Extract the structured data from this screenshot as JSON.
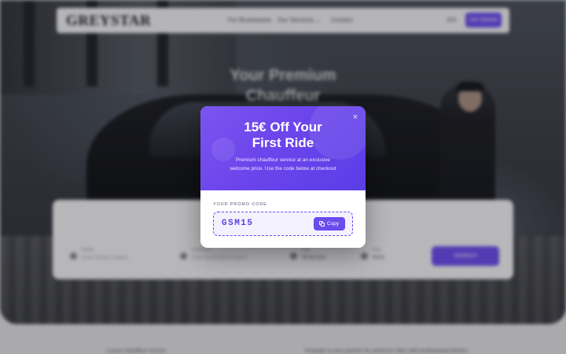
{
  "navbar": {
    "logo": "GREYSTAR",
    "links": [
      "For Businesses",
      "Our Services ⌄",
      "Contact"
    ],
    "lang": "EN",
    "cta": "Get Started"
  },
  "hero": {
    "title_line1": "Your Premium",
    "title_line2": "Chauffeur"
  },
  "booking": {
    "fields": [
      {
        "label": "Pickup",
        "value": "Enter Pickup Location",
        "icon": "location-pin-icon"
      },
      {
        "label": "Destination",
        "value": "Enter Destination Location",
        "icon": "location-pin-icon"
      },
      {
        "label": "Date",
        "value": "08.08.2024",
        "icon": "calendar-icon"
      },
      {
        "label": "Time",
        "value": "09:00",
        "icon": "clock-icon"
      }
    ],
    "search_label": "SEARCH"
  },
  "below": {
    "left": "Luxury chauffeur service",
    "right": "Greystar is your partner for premium rides with professional drivers"
  },
  "modal": {
    "title_line1": "15€ Off Your",
    "title_line2": "First Ride",
    "subtitle_line1": "Premium chauffeur service at an exclusive",
    "subtitle_line2": "welcome price. Use the code below at checkout",
    "promo_label": "YOUR PROMO CODE",
    "promo_code": "GSM15",
    "copy_label": "Copy",
    "close_symbol": "×"
  },
  "colors": {
    "accent": "#6a4bee",
    "modal_gradient_start": "#7b55f0",
    "modal_gradient_end": "#5a3de6"
  }
}
